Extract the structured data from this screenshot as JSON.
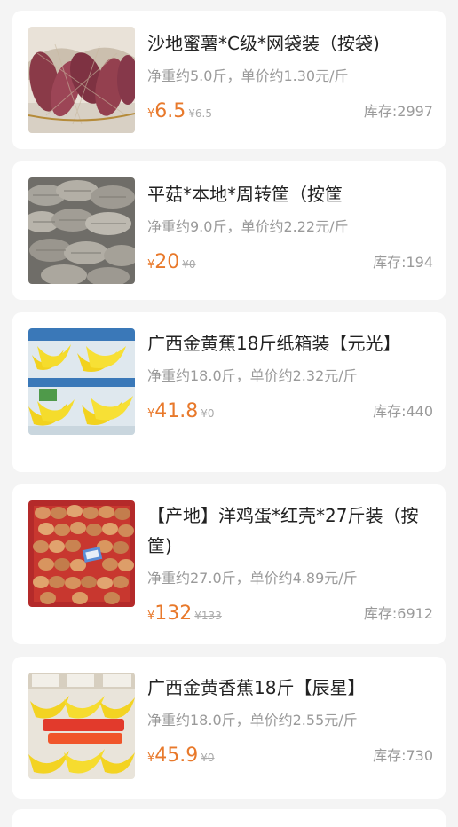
{
  "products": [
    {
      "title": "沙地蜜薯*C级*网袋装（按袋)",
      "desc": "净重约5.0斤，单价约1.30元/斤",
      "currency": "¥",
      "price": "6.5",
      "original_price": "¥6.5",
      "stock": "库存:2997",
      "image": "sweet-potato-image"
    },
    {
      "title": "平菇*本地*周转筐（按筐",
      "desc": "净重约9.0斤，单价约2.22元/斤",
      "currency": "¥",
      "price": "20",
      "original_price": "¥0",
      "stock": "库存:194",
      "image": "oyster-mushroom-image"
    },
    {
      "title": "广西金黄蕉18斤纸箱装【元光】",
      "desc": "净重约18.0斤，单价约2.32元/斤",
      "currency": "¥",
      "price": "41.8",
      "original_price": "¥0",
      "stock": "库存:440",
      "image": "banana-box-image"
    },
    {
      "title": "【产地】洋鸡蛋*红壳*27斤装（按筐)",
      "desc": "净重约27.0斤，单价约4.89元/斤",
      "currency": "¥",
      "price": "132",
      "original_price": "¥133",
      "stock": "库存:6912",
      "image": "eggs-crate-image"
    },
    {
      "title": "广西金黄香蕉18斤【辰星】",
      "desc": "净重约18.0斤，单价约2.55元/斤",
      "currency": "¥",
      "price": "45.9",
      "original_price": "¥0",
      "stock": "库存:730",
      "image": "banana-stand-image"
    }
  ]
}
